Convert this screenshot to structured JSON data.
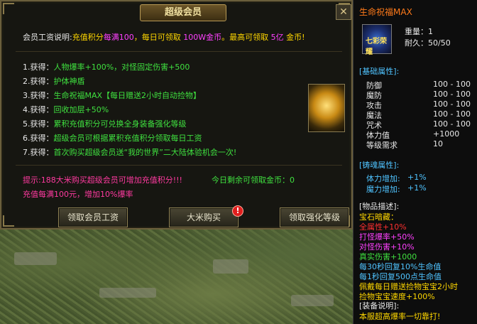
{
  "dialog": {
    "title": "超级会员",
    "close_glyph": "✕",
    "wage_label": "会员工资说明:",
    "wage_rule_a": "充值积分",
    "wage_rule_b": "每满100",
    "wage_rule_c": "，每日可领取",
    "wage_rule_d": "100W金币",
    "wage_rule_e": "。最高可领取",
    "wage_rule_f": "5亿",
    "wage_rule_g": "金币!",
    "benefits": [
      {
        "no": "1.获得：",
        "text": "人物爆率+100%，对怪固定伤害+500"
      },
      {
        "no": "2.获得：",
        "text": "护体神盾"
      },
      {
        "no": "3.获得：",
        "text": "生命祝福MAX【每日赠送2小时自动捡物】"
      },
      {
        "no": "4.获得：",
        "text": "回收加层+50%"
      },
      {
        "no": "5.获得：",
        "text": "累积充值积分可兑换全身装备强化等级"
      },
      {
        "no": "6.获得：",
        "text": "超级会员可根据累积充值积分领取每日工资"
      },
      {
        "no": "7.获得：",
        "text": "首次购买超级会员送“我的世界”二大陆体验机会一次!"
      }
    ],
    "tip": "提示:188大米购买超级会员可增加充值积分!!!",
    "today_label": "今日剩余可领取金币：",
    "today_value": "0",
    "recharge_note": "充值每满100元，增加10%爆率",
    "buttons": {
      "claim_wage": "领取会员工资",
      "buy_rice": "大米购买",
      "claim_level": "领取强化等级"
    },
    "alert_glyph": "!"
  },
  "item": {
    "name": "生命祝福MAX",
    "icon_caption": "七彩荣耀",
    "weight_label": "重量：",
    "weight_value": "1",
    "durability_label": "耐久：",
    "durability_value": "50/50",
    "base_header": "[基础属性]:",
    "base_stats": [
      {
        "label": "防御",
        "value": "100 - 100"
      },
      {
        "label": "魔防",
        "value": "100 - 100"
      },
      {
        "label": "攻击",
        "value": "100 - 100"
      },
      {
        "label": "魔法",
        "value": "100 - 100"
      },
      {
        "label": "咒术",
        "value": "100 - 100"
      },
      {
        "label": "体力值",
        "value": "+1000"
      },
      {
        "label": "等级需求",
        "value": "10"
      }
    ],
    "soul_header": "[铸魂属性]:",
    "soul_stats": [
      {
        "label": "体力增加:",
        "value": "+1%"
      },
      {
        "label": "魔力增加:",
        "value": "+1%"
      }
    ],
    "desc_header": "[物品描述]:",
    "desc_lines": [
      {
        "text": "宝石暗藏：",
        "color": "#ffd700"
      },
      {
        "text": "全属性+10%",
        "color": "#ff3030"
      },
      {
        "text": "打怪爆率+50%",
        "color": "#ff40ff"
      },
      {
        "text": "对怪伤害+10%",
        "color": "#ff40ff"
      },
      {
        "text": "真实伤害+1000",
        "color": "#3fe03f"
      },
      {
        "text": "每30秒回复10%生命值",
        "color": "#4fc3ff"
      },
      {
        "text": "每1秒回复500点生命值",
        "color": "#4fc3ff"
      },
      {
        "text": "佩戴每日赠送捡物宝宝2小时",
        "color": "#ffd700"
      },
      {
        "text": "捡物宝宝速度+100%",
        "color": "#ffd700"
      }
    ],
    "equip_header": "[装备说明]:",
    "equip_note": "本服超高爆率一切靠打!"
  }
}
